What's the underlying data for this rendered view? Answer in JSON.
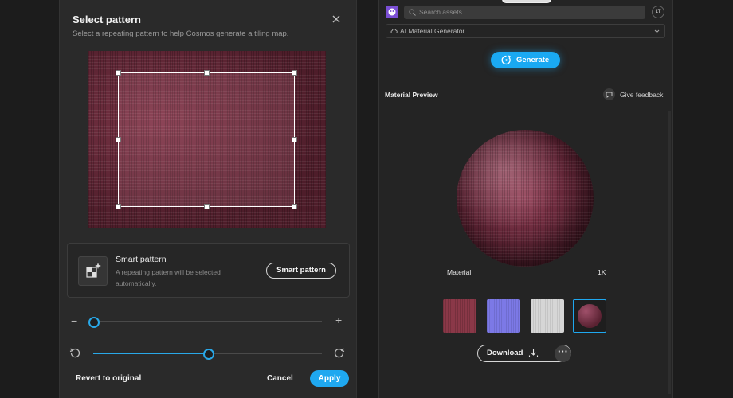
{
  "dialog": {
    "title": "Select pattern",
    "subtitle": "Select a repeating pattern to help Cosmos generate a tiling map.",
    "close_icon": "close-icon",
    "smart_pattern": {
      "title": "Smart pattern",
      "description": "A repeating pattern will be selected automatically.",
      "button_label": "Smart pattern",
      "icon": "smart-pattern-icon"
    },
    "zoom_slider": {
      "minus": "−",
      "plus": "+",
      "value_fraction": 0.0
    },
    "rotation_slider": {
      "value_fraction": 0.5,
      "left_icon": "rotate-left-icon",
      "right_icon": "rotate-right-icon"
    },
    "footer": {
      "revert_label": "Revert to original",
      "cancel_label": "Cancel",
      "apply_label": "Apply"
    }
  },
  "panel": {
    "search": {
      "placeholder": "Search assets ..."
    },
    "avatar_initials": "LT",
    "mode": {
      "label": "AI Material Generator",
      "icon": "cloud-icon"
    },
    "generate_label": "Generate",
    "preview": {
      "heading": "Material Preview",
      "feedback_label": "Give feedback",
      "material_label": "Material",
      "resolution_label": "1K"
    },
    "thumbnails": [
      {
        "name": "Base color",
        "color": "#8a3848"
      },
      {
        "name": "Normal",
        "color": "#7c79e6"
      },
      {
        "name": "Roughness",
        "color": "#d6d6d6"
      },
      {
        "name": "Sphere",
        "color": "#6b2a3a",
        "selected": true
      }
    ],
    "download_label": "Download",
    "more_label": "···"
  },
  "colors": {
    "accent": "#1fa8f0",
    "dialog_bg": "#2a2a2a",
    "panel_bg": "#242424"
  }
}
